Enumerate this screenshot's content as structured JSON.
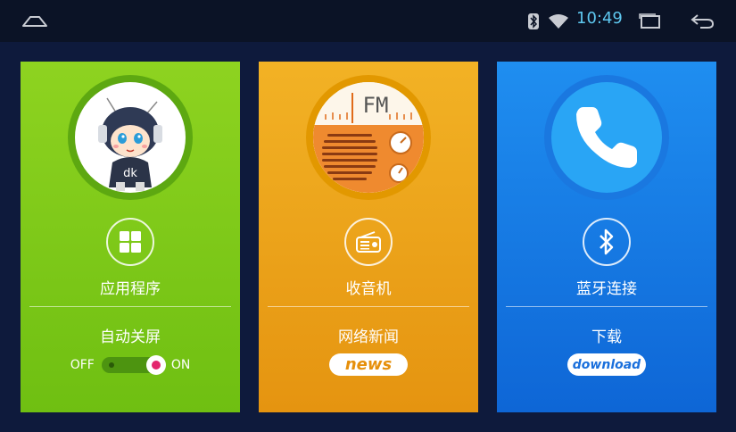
{
  "statusbar": {
    "time": "10:49",
    "icons": [
      "home-icon",
      "bluetooth-icon",
      "wifi-icon",
      "recents-icon",
      "back-icon"
    ]
  },
  "cards": {
    "apps": {
      "title": "应用程序",
      "subtitle": "自动关屏",
      "toggle_off": "OFF",
      "toggle_on": "ON",
      "toggle_state": "on",
      "color": "#7cc91a"
    },
    "radio": {
      "title": "收音机",
      "subtitle": "网络新闻",
      "fm_label": "FM",
      "pill": "news",
      "color": "#eea51b"
    },
    "phone": {
      "title": "蓝牙连接",
      "subtitle": "下载",
      "pill": "download",
      "color": "#167de6"
    }
  },
  "mascot": {
    "badge": "dk"
  }
}
